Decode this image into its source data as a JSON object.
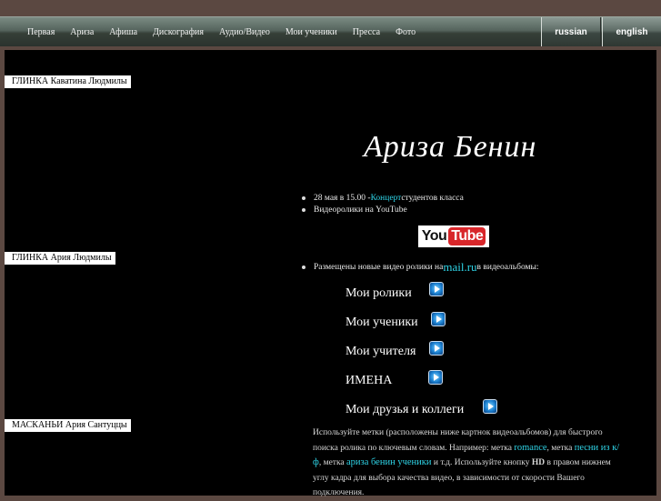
{
  "nav": {
    "items": [
      "Первая",
      "Ариза",
      "Афиша",
      "Дискография",
      "Аудио/Видео",
      "Мои ученики",
      "Пресса",
      "Фото"
    ],
    "languages": [
      "russian",
      "english"
    ]
  },
  "left_videos": [
    {
      "title": "ГЛИНКА Каватина Людмилы"
    },
    {
      "title": "ГЛИНКА Ария Людмилы"
    },
    {
      "title": "МАСКАНЬИ Ария Сантуццы"
    }
  ],
  "main": {
    "title": "Ариза Бенин",
    "news1": {
      "prefix": "28 мая в 15.00 - ",
      "link": "Концерт",
      "suffix": " студентов класса"
    },
    "news2": "Видеоролики  на YouTube",
    "youtube": {
      "you": "You",
      "tube": "Tube"
    },
    "news3": {
      "prefix": "Размещены новые видео ролики на ",
      "link": "mail.ru",
      "suffix": " в видеоальбомы:"
    },
    "albums": [
      "Мои ролики",
      "Мои ученики",
      "Мои учителя",
      "ИМЕНА",
      "Мои друзья и коллеги"
    ],
    "paragraph": {
      "p1": "Используйте метки (расположены ниже картнок видеоальбомов) для быстрого поиска ролика по ключевым словам. Например: метка ",
      "l1": "romance",
      "p2": ", метка ",
      "l2": "песни из к/ф",
      "p3": ", метка ",
      "l3": "ариза бенин ученики",
      "p4": " и т.д. Используйте кнопку ",
      "hd": "HD",
      "p5": " в правом нижнем углу кадра для выбора качества видео, в зависимости от скорости Вашего подключения."
    }
  },
  "colors": {
    "link": "#2fd5e8",
    "background": "#000000",
    "frame": "#5b4841"
  },
  "icons": {
    "album_icon": "video-camera-icon",
    "bullet": "bullet-dot-icon"
  }
}
